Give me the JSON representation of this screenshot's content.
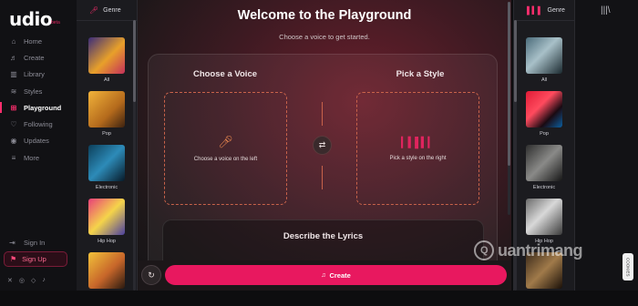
{
  "app": {
    "logo": "udio",
    "logo_badge": "beta"
  },
  "nav": [
    {
      "icon": "⌂",
      "label": "Home"
    },
    {
      "icon": "♬",
      "label": "Create"
    },
    {
      "icon": "▥",
      "label": "Library"
    },
    {
      "icon": "≋",
      "label": "Styles"
    },
    {
      "icon": "⊞",
      "label": "Playground"
    },
    {
      "icon": "♡",
      "label": "Following"
    },
    {
      "icon": "◉",
      "label": "Updates"
    },
    {
      "icon": "≡",
      "label": "More"
    }
  ],
  "account": {
    "signin_icon": "⇥",
    "signin_label": "Sign In",
    "signup_icon": "⚑",
    "signup_label": "Sign Up"
  },
  "socials": [
    "✕",
    "◎",
    "◇",
    "♪"
  ],
  "genre_left": {
    "header": "Genre",
    "items": [
      {
        "label": "All"
      },
      {
        "label": "Pop"
      },
      {
        "label": "Electronic"
      },
      {
        "label": "Hip Hop"
      },
      {
        "label": ""
      }
    ]
  },
  "genre_right": {
    "header": "Genre",
    "items": [
      {
        "label": "All"
      },
      {
        "label": "Pop"
      },
      {
        "label": "Electronic"
      },
      {
        "label": "Hip Hop"
      },
      {
        "label": ""
      }
    ]
  },
  "main": {
    "title": "Welcome to the Playground",
    "subtitle": "Choose a voice to get started.",
    "voice": {
      "title": "Choose a Voice",
      "hint": "Choose a voice on the left"
    },
    "style": {
      "title": "Pick a Style",
      "hint": "Pick a style on the right"
    },
    "lyrics": {
      "title": "Describe the Lyrics"
    },
    "create_label": "Create"
  },
  "right_panel": {
    "cookie_label": "COOKIES"
  },
  "watermark": {
    "text": "uantrimang"
  },
  "colors": {
    "accent": "#e8185f",
    "dashed_border": "#c8624a"
  }
}
